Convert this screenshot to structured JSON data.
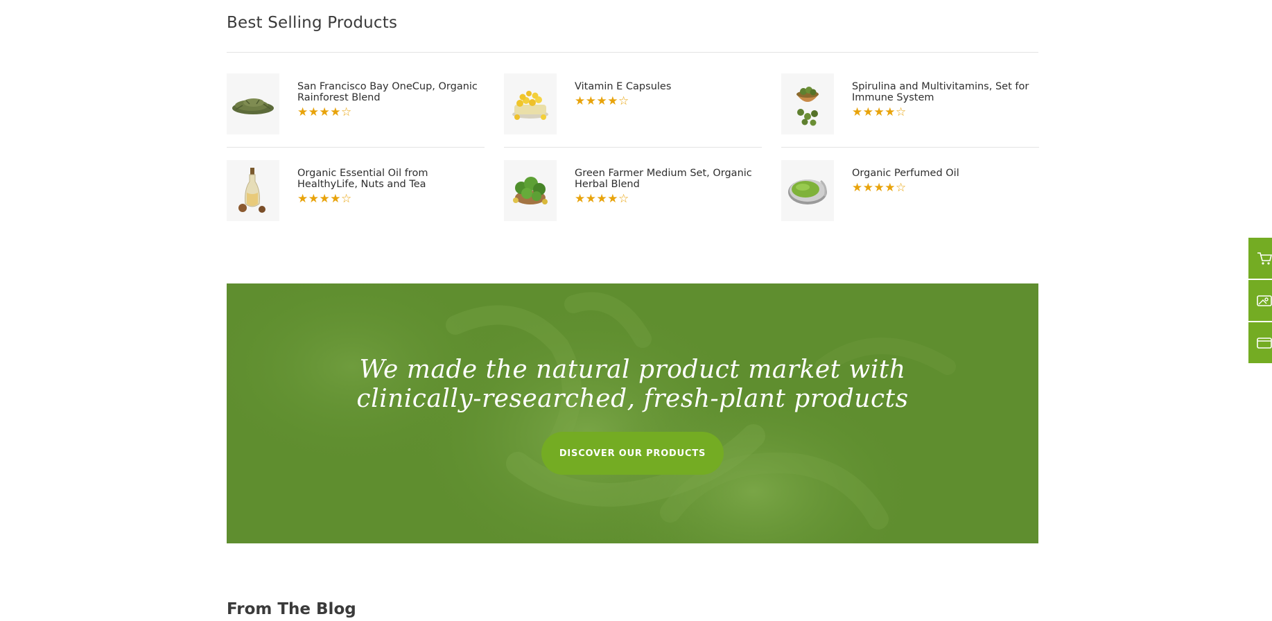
{
  "best_selling": {
    "title": "Best Selling Products",
    "products": [
      {
        "name": "San Francisco Bay OneCup, Organic Rainforest Blend",
        "rating": 4.5,
        "stars": "★★★★",
        "icon": "tea-leaves-image"
      },
      {
        "name": "Vitamin E Capsules",
        "rating": 4.5,
        "stars": "★★★★",
        "icon": "capsules-image"
      },
      {
        "name": "Spirulina and Multivitamins, Set for Immune System",
        "rating": 4.5,
        "stars": "★★★★",
        "icon": "spirulina-bowl-image"
      },
      {
        "name": "Organic Essential Oil from HealthyLife, Nuts and Tea",
        "rating": 4.5,
        "stars": "★★★★",
        "icon": "oil-bottle-image"
      },
      {
        "name": "Green Farmer Medium Set, Organic Herbal Blend",
        "rating": 4.5,
        "stars": "★★★★",
        "icon": "herbal-bowl-image"
      },
      {
        "name": "Organic Perfumed Oil",
        "rating": 4.5,
        "stars": "★★★★",
        "icon": "oil-tin-image"
      }
    ]
  },
  "banner": {
    "headline_line1": "We made the natural product market with",
    "headline_line2": "clinically-researched, fresh-plant products",
    "cta_label": "DISCOVER OUR PRODUCTS"
  },
  "blog": {
    "title": "From The Blog"
  },
  "side_toolbar": {
    "items": [
      "cart-icon",
      "image-icon",
      "window-icon"
    ]
  },
  "colors": {
    "accent_green": "#74ac23",
    "banner_green": "#5f8e2f",
    "star_gold": "#e8a30b",
    "text_dark": "#2e2e2e"
  }
}
